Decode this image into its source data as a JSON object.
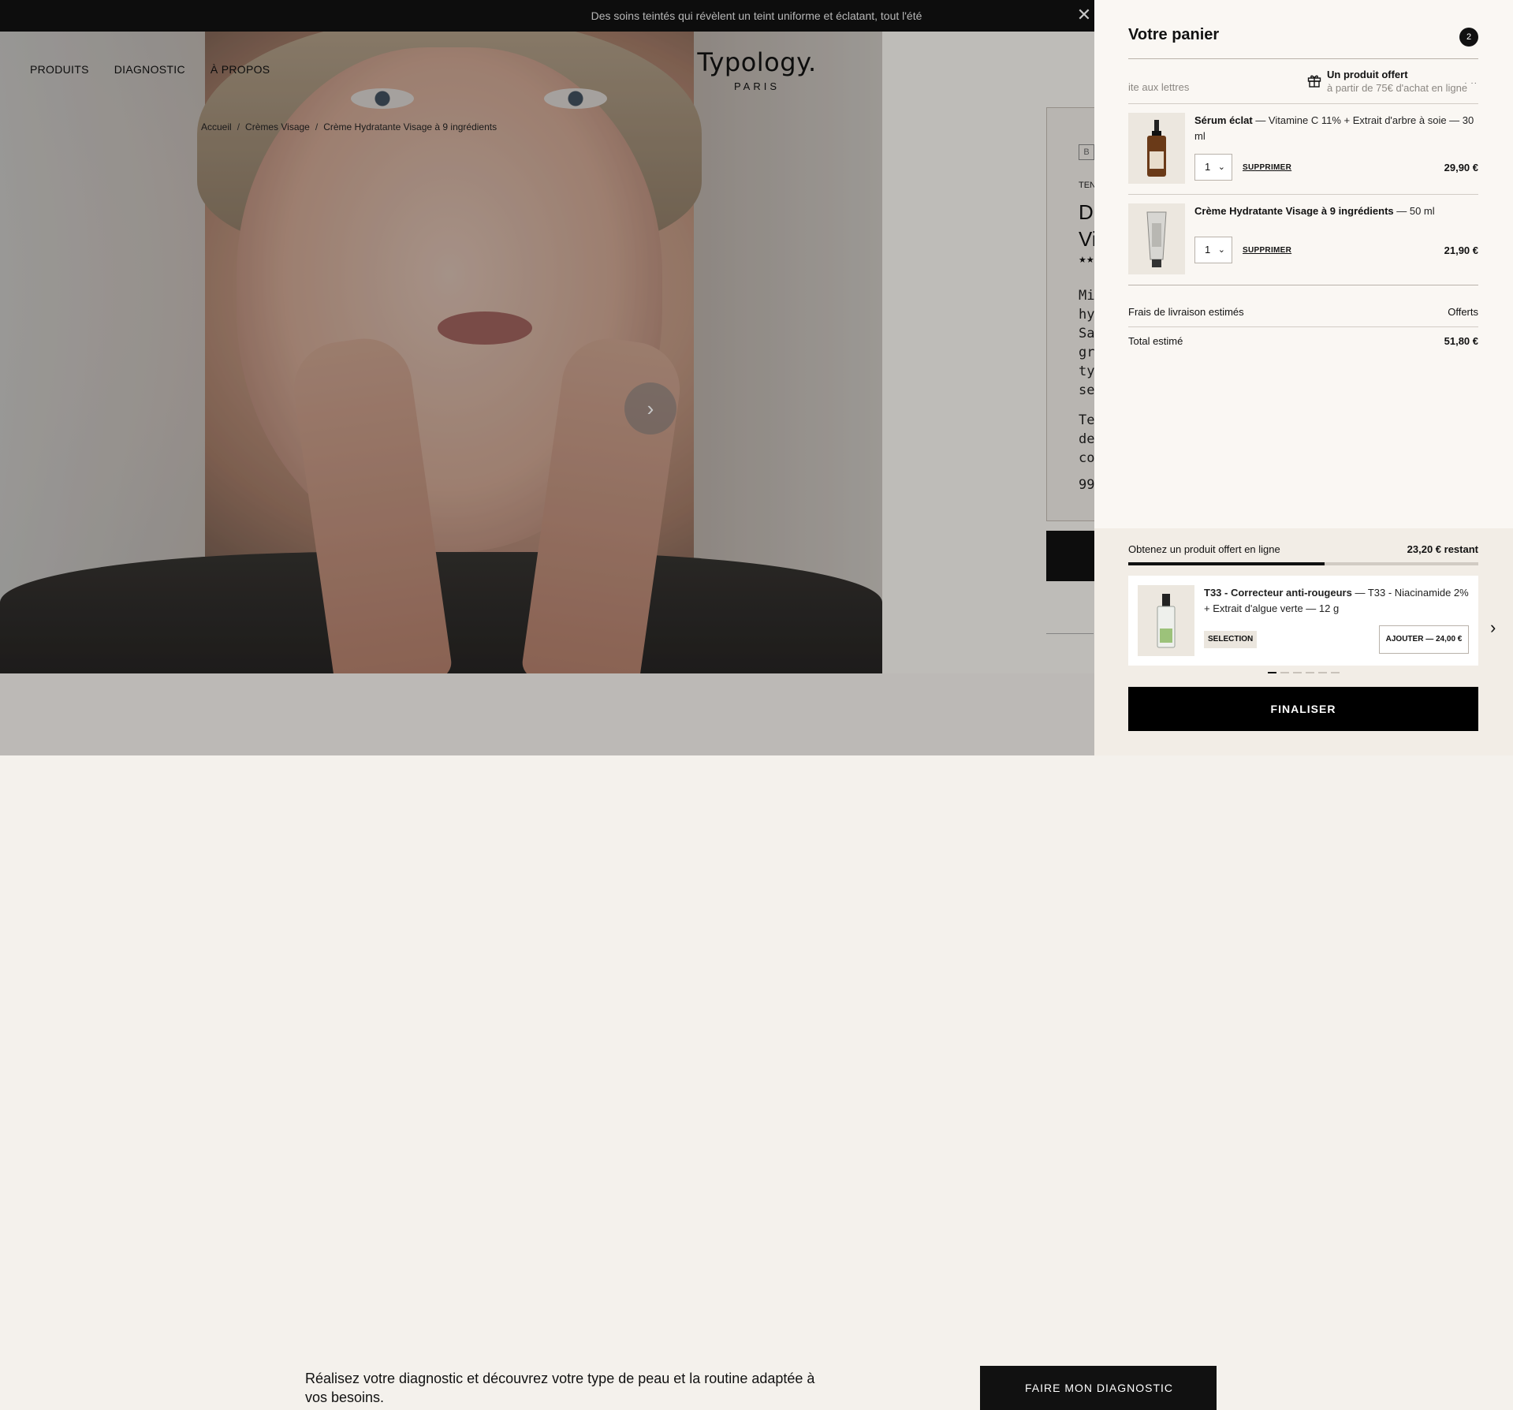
{
  "announcement": {
    "text": "Des soins teintés qui révèlent un teint uniforme et éclatant, tout l'été"
  },
  "nav": {
    "items": [
      "PRODUITS",
      "DIAGNOSTIC",
      "À PROPOS"
    ]
  },
  "logo": {
    "main": "Typology.",
    "sub": "PARIS"
  },
  "breadcrumb": {
    "items": [
      "Accueil",
      "Crèmes Visage",
      "Crème Hydratante Visage à 9 ingrédients"
    ],
    "separator": "/"
  },
  "product_peek": {
    "badge": "B",
    "small": "TEN",
    "title_lines": [
      "D",
      "Vi"
    ],
    "stars": "★★",
    "desc_lines": [
      "Mi",
      "hy",
      "Sa",
      "gr",
      "ty",
      "se"
    ],
    "desc2_lines": [
      "Te",
      "de",
      "co"
    ],
    "desc3": "99"
  },
  "diagnostic": {
    "text": "Réalisez votre diagnostic et découvrez votre type de peau et la routine adaptée à vos besoins.",
    "button": "FAIRE MON DIAGNOSTIC"
  },
  "cart": {
    "title": "Votre panier",
    "count": "2",
    "promo": {
      "left_text": "ite aux lettres",
      "title": "Un produit offert",
      "subtitle": "à partir de 75€ d'achat en ligne"
    },
    "items": [
      {
        "name": "Sérum éclat",
        "detail": " — Vitamine C 11% + Extrait d'arbre à soie — 30 ml",
        "qty": "1",
        "remove": "SUPPRIMER",
        "price": "29,90 €"
      },
      {
        "name": "Crème Hydratante Visage à 9 ingrédients",
        "detail": " — 50 ml",
        "qty": "1",
        "remove": "SUPPRIMER",
        "price": "21,90 €"
      }
    ],
    "shipping": {
      "label": "Frais de livraison estimés",
      "value": "Offerts"
    },
    "total": {
      "label": "Total estimé",
      "value": "51,80 €"
    },
    "offer": {
      "label": "Obtenez un produit offert en ligne",
      "remaining": "23,20 € restant",
      "progress_fraction": 0.56
    },
    "upsell": {
      "name": "T33 - Correcteur anti-rougeurs",
      "detail": " — T33 - Niacinamide 2% + Extrait d'algue verte — 12 g",
      "tag": "SELECTION",
      "add": "AJOUTER — 24,00 €",
      "slides_total": 6,
      "slide_active": 1
    },
    "finalize": "FINALISER"
  },
  "icons": {
    "close": "close-icon",
    "chevron_right": "chevron-right-icon",
    "gift": "gift-icon",
    "chevron_down": "chevron-down-icon"
  }
}
